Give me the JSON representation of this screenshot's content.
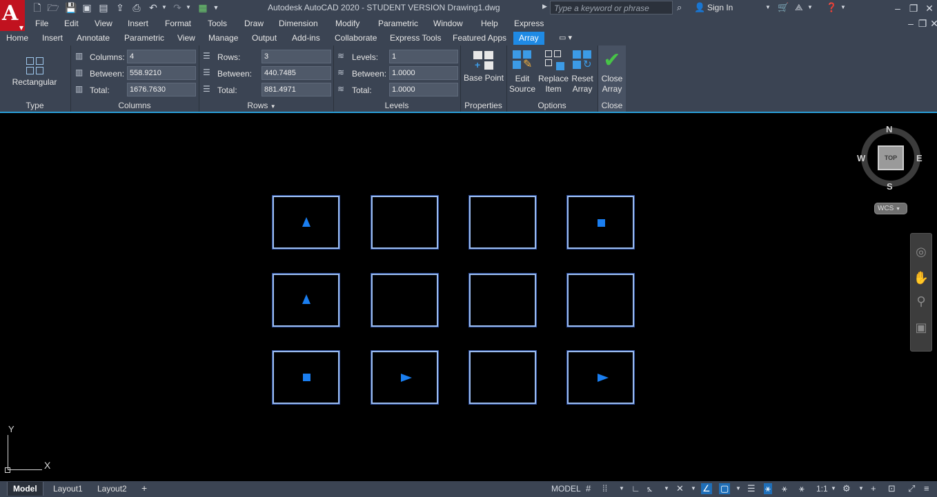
{
  "window": {
    "title": "Autodesk AutoCAD 2020 - STUDENT VERSION    Drawing1.dwg",
    "logo": "A",
    "search_placeholder": "Type a keyword or phrase",
    "sign_in": "Sign In"
  },
  "menu": [
    "File",
    "Edit",
    "View",
    "Insert",
    "Format",
    "Tools",
    "Draw",
    "Dimension",
    "Modify",
    "Parametric",
    "Window",
    "Help",
    "Express"
  ],
  "ribbon_tabs": [
    "Home",
    "Insert",
    "Annotate",
    "Parametric",
    "View",
    "Manage",
    "Output",
    "Add-ins",
    "Collaborate",
    "Express Tools",
    "Featured Apps",
    "Array"
  ],
  "active_ribbon_tab": "Array",
  "ribbon": {
    "type": {
      "button": "Rectangular",
      "title": "Type"
    },
    "columns": {
      "title": "Columns",
      "count_label": "Columns:",
      "count_value": "4",
      "between_label": "Between:",
      "between_value": "558.9210",
      "total_label": "Total:",
      "total_value": "1676.7630"
    },
    "rows": {
      "title": "Rows",
      "count_label": "Rows:",
      "count_value": "3",
      "between_label": "Between:",
      "between_value": "440.7485",
      "total_label": "Total:",
      "total_value": "881.4971"
    },
    "levels": {
      "title": "Levels",
      "count_label": "Levels:",
      "count_value": "1",
      "between_label": "Between:",
      "between_value": "1.0000",
      "total_label": "Total:",
      "total_value": "1.0000"
    },
    "properties": {
      "button": "Base Point",
      "title": "Properties"
    },
    "options": {
      "title": "Options",
      "edit_source_1": "Edit",
      "edit_source_2": "Source",
      "replace_item_1": "Replace",
      "replace_item_2": "Item",
      "reset_array_1": "Reset",
      "reset_array_2": "Array"
    },
    "close": {
      "button_1": "Close",
      "button_2": "Array",
      "title": "Close"
    }
  },
  "viewcube": {
    "face": "TOP",
    "north": "N",
    "south": "S",
    "east": "E",
    "west": "W",
    "ucs": "WCS"
  },
  "ucs_icon": {
    "x": "X",
    "y": "Y"
  },
  "layout_tabs": [
    "Model",
    "Layout1",
    "Layout2"
  ],
  "add_layout": "+",
  "status": {
    "space": "MODEL",
    "scale": "1:1"
  },
  "colors": {
    "accent": "#1f8ae4",
    "cell_border": "#9bbcef",
    "marker": "#1a7ef0",
    "ribbon_bg": "#3b4453"
  }
}
